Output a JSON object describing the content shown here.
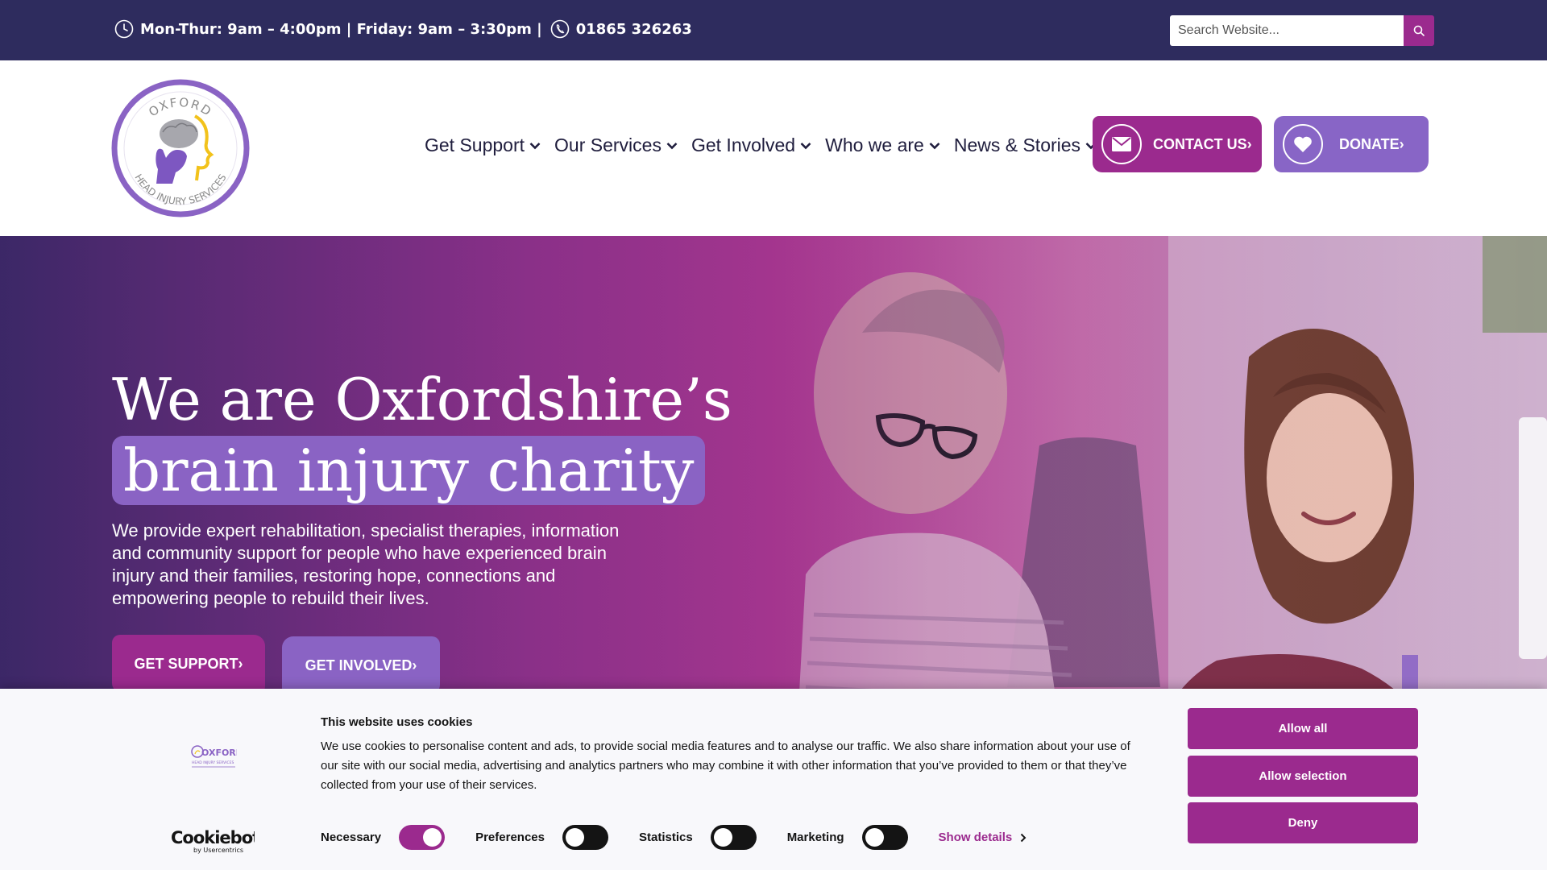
{
  "topbar": {
    "hours": "Mon-Thur: 9am – 4:00pm | Friday: 9am – 3:30pm |",
    "phone": "01865 326263",
    "search_placeholder": "Search Website...",
    "icons": [
      "clock-icon",
      "phone-icon",
      "search-icon"
    ]
  },
  "logo": {
    "top_text": "OXFORD",
    "bottom_text": "HEAD INJURY SERVICES"
  },
  "nav": {
    "items": [
      {
        "label": "Get Support"
      },
      {
        "label": "Our Services"
      },
      {
        "label": "Get Involved"
      },
      {
        "label": "Who we are"
      },
      {
        "label": "News & Stories"
      }
    ]
  },
  "header_buttons": {
    "contact": "CONTACT US›",
    "donate": "DONATE›"
  },
  "hero": {
    "title_line1": "We are Oxfordshire’s",
    "title_line2": "brain injury charity",
    "text": "We provide expert rehabilitation, specialist therapies, information and community support for people who have experienced brain injury and their families, restoring hope, connections and empowering people to rebuild their lives.",
    "btn_support": "GET SUPPORT›",
    "btn_involved": "GET INVOLVED›"
  },
  "cookie": {
    "title": "This website uses cookies",
    "body": "We use cookies to personalise content and ads, to provide social media features and to analyse our traffic. We also share information about your use of our site with our social media, advertising and analytics partners who may combine it with other information that you’ve provided to them or that they’ve collected from your use of their services.",
    "logo_text": "OXFORD",
    "logo_subtext": "HEAD INJURY SERVICES",
    "brand": "Cookiebot",
    "brand_sub": "by Usercentrics",
    "toggles": [
      {
        "label": "Necessary",
        "on": true
      },
      {
        "label": "Preferences",
        "on": false
      },
      {
        "label": "Statistics",
        "on": false
      },
      {
        "label": "Marketing",
        "on": false
      }
    ],
    "show_details": "Show details",
    "allow_all": "Allow all",
    "allow_selection": "Allow selection",
    "deny": "Deny"
  },
  "colors": {
    "topbar": "#2e2c5e",
    "magenta": "#9b2a8e",
    "purple": "#8a63c4"
  }
}
